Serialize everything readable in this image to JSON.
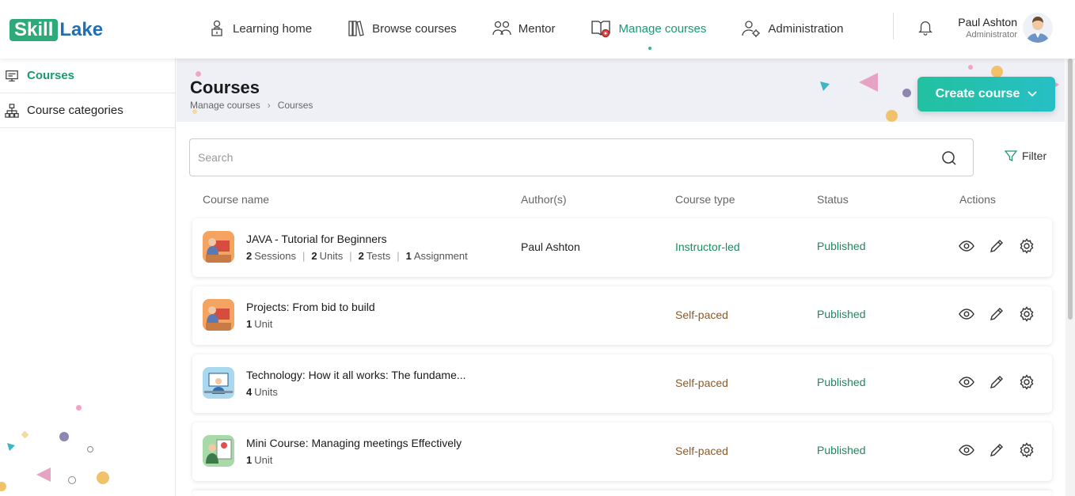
{
  "header": {
    "logo_part1": "Skill",
    "logo_part2": "Lake",
    "nav": [
      {
        "label": "Learning home",
        "icon": "learning-home-icon"
      },
      {
        "label": "Browse courses",
        "icon": "books-icon"
      },
      {
        "label": "Mentor",
        "icon": "mentor-icon"
      },
      {
        "label": "Manage courses",
        "icon": "manage-courses-icon",
        "active": true
      },
      {
        "label": "Administration",
        "icon": "admin-icon"
      }
    ],
    "user": {
      "name": "Paul Ashton",
      "role": "Administrator"
    }
  },
  "sidebar": {
    "items": [
      {
        "label": "Courses",
        "icon": "monitor-icon",
        "active": true
      },
      {
        "label": "Course categories",
        "icon": "hierarchy-icon"
      }
    ]
  },
  "page": {
    "title": "Courses",
    "breadcrumb": [
      "Manage courses",
      "Courses"
    ],
    "create_label": "Create course",
    "search_placeholder": "Search",
    "filter_label": "Filter"
  },
  "table": {
    "headers": [
      "Course name",
      "Author(s)",
      "Course type",
      "Status",
      "Actions"
    ],
    "rows": [
      {
        "name": "JAVA - Tutorial for Beginners",
        "meta": [
          {
            "count": "2",
            "label": "Sessions"
          },
          {
            "count": "2",
            "label": "Units"
          },
          {
            "count": "2",
            "label": "Tests"
          },
          {
            "count": "1",
            "label": "Assignment"
          }
        ],
        "author": "Paul Ashton",
        "type": "Instructor-led",
        "status": "Published"
      },
      {
        "name": "Projects: From bid to build",
        "meta": [
          {
            "count": "1",
            "label": "Unit"
          }
        ],
        "author": "",
        "type": "Self-paced",
        "status": "Published"
      },
      {
        "name": "Technology: How it all works: The fundame...",
        "meta": [
          {
            "count": "4",
            "label": "Units"
          }
        ],
        "author": "",
        "type": "Self-paced",
        "status": "Published"
      },
      {
        "name": "Mini Course: Managing meetings Effectively",
        "meta": [
          {
            "count": "1",
            "label": "Unit"
          }
        ],
        "author": "",
        "type": "Self-paced",
        "status": "Published"
      }
    ]
  },
  "colors": {
    "accent": "#1a9973",
    "brand_green": "#2eaa7a",
    "brand_blue": "#1f6fb6",
    "self_paced": "#8a5a2b"
  }
}
